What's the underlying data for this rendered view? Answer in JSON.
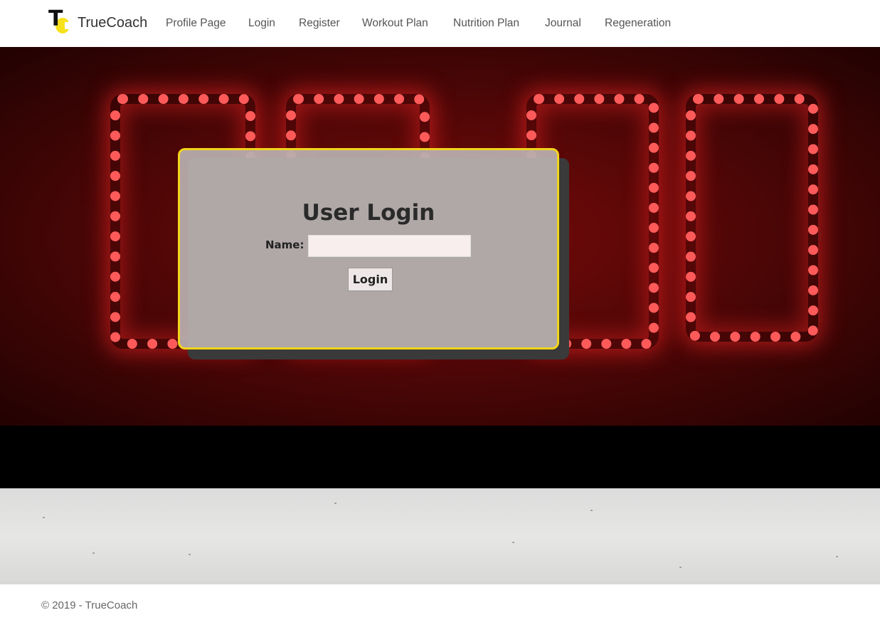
{
  "brand": {
    "logo_text": "T",
    "name": "TrueCoach"
  },
  "nav": {
    "profile": "Profile Page",
    "login": "Login",
    "register": "Register",
    "workout": "Workout Plan",
    "nutrition": "Nutrition Plan",
    "journal": "Journal",
    "regeneration": "Regeneration"
  },
  "login_form": {
    "title": "User Login",
    "name_label": "Name:",
    "name_value": "",
    "submit_label": "Login"
  },
  "footer": {
    "text": "© 2019 - TrueCoach"
  },
  "colors": {
    "accent": "#f2d51a",
    "hero": "#4a0606",
    "led": "#ff5a5a"
  }
}
